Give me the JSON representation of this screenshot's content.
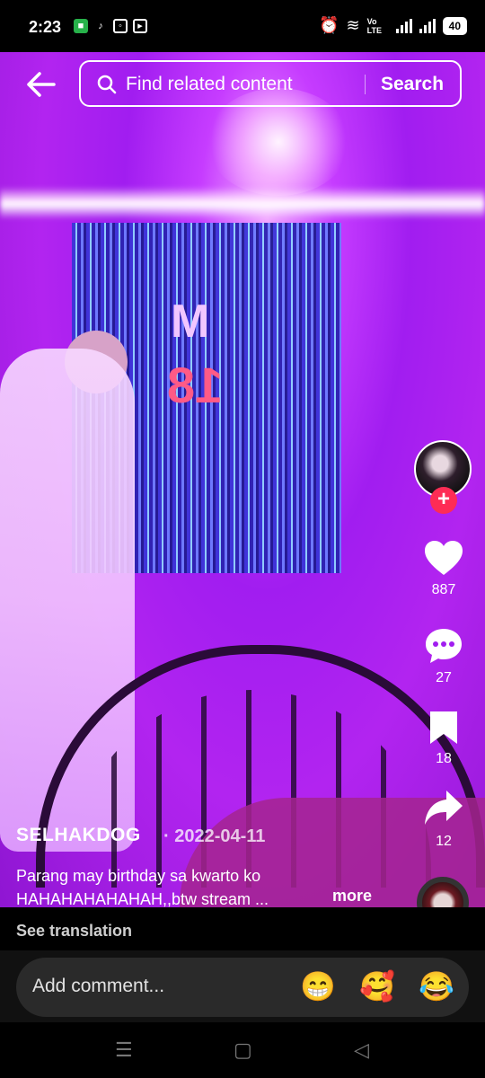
{
  "status_bar": {
    "time": "2:23",
    "network_label": "Vo LTE",
    "battery": "40"
  },
  "top_bar": {
    "search_placeholder": "Find related content",
    "search_button": "Search"
  },
  "video_scene": {
    "banner_letters": "M",
    "balloon_number": "18"
  },
  "actions": {
    "likes": "887",
    "comments": "27",
    "saves": "18",
    "shares": "12",
    "follow_symbol": "+"
  },
  "post": {
    "username": "SELHAKDOG",
    "date": "· 2022-04-11",
    "caption_line1": "Parang may birthday sa kwarto ko",
    "caption_line2": "HAHAHAHAHAHAH,,btw stream ...",
    "more_label": "more",
    "see_translation": "See translation"
  },
  "comment_bar": {
    "placeholder": "Add comment...",
    "emojis": [
      "😁",
      "🥰",
      "😂"
    ]
  },
  "colors": {
    "accent_red": "#fe2c55",
    "video_purple": "#a11df0"
  }
}
